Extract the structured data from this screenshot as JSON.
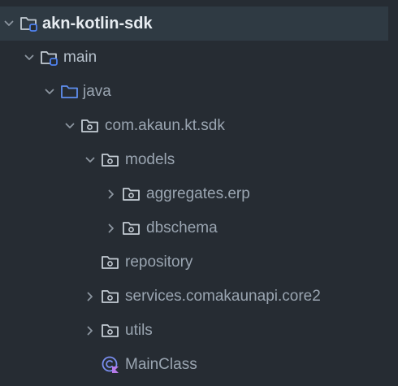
{
  "project_tree": {
    "root": {
      "label": "akn-kotlin-sdk",
      "icon": "module-folder-icon",
      "expanded": true
    },
    "main": {
      "label": "main",
      "icon": "source-set-folder-icon",
      "expanded": true
    },
    "java": {
      "label": "java",
      "icon": "source-root-folder-icon",
      "expanded": true
    },
    "package_root": {
      "label": "com.akaun.kt.sdk",
      "icon": "package-icon",
      "expanded": true
    },
    "models": {
      "label": "models",
      "icon": "package-icon",
      "expanded": true
    },
    "aggregates": {
      "label": "aggregates.erp",
      "icon": "package-icon",
      "expanded": false
    },
    "dbschema": {
      "label": "dbschema",
      "icon": "package-icon",
      "expanded": false
    },
    "repository": {
      "label": "repository",
      "icon": "package-icon"
    },
    "services": {
      "label": "services.comakaunapi.core2",
      "icon": "package-icon",
      "expanded": false
    },
    "utils": {
      "label": "utils",
      "icon": "package-icon",
      "expanded": false
    },
    "main_class": {
      "label": "MainClass",
      "icon": "kotlin-class-icon"
    }
  },
  "colors": {
    "background": "#262c33",
    "selected_row": "#2f3a43",
    "text": "#9aa5b1",
    "root_text": "#e8edf2",
    "chevron": "#8c96a0",
    "folder_stroke": "#c4ccd4",
    "source_folder_stroke": "#5f8ff0",
    "module_badge": "#4f82f0",
    "kotlin_class": "#7a8ef0"
  }
}
